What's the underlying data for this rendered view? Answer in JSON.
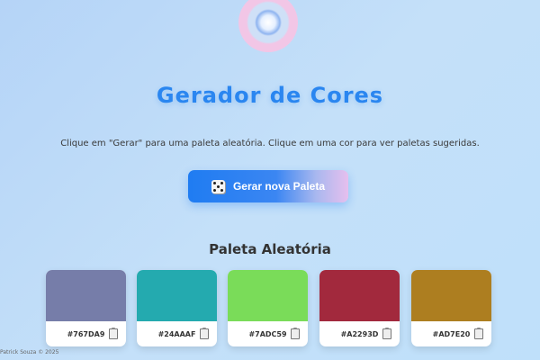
{
  "header": {
    "title": "Gerador de Cores",
    "instructions": "Clique em \"Gerar\" para uma paleta aleatória. Clique em uma cor para ver paletas sugeridas."
  },
  "generate_button": {
    "icon": "dice-icon",
    "label": "Gerar nova Paleta"
  },
  "palette": {
    "title": "Paleta Aleatória",
    "colors": [
      {
        "hex": "#767DA9"
      },
      {
        "hex": "#24AAAF"
      },
      {
        "hex": "#7ADC59"
      },
      {
        "hex": "#A2293D"
      },
      {
        "hex": "#AD7E20"
      }
    ]
  },
  "footer": {
    "text": "Patrick Souza © 2025"
  }
}
